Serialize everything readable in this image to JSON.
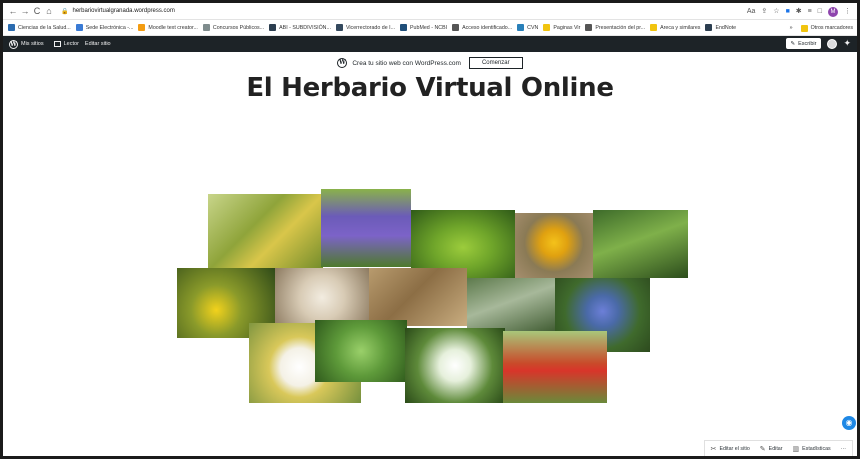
{
  "browser": {
    "url": "herbariovirtualgranada.wordpress.com",
    "profile_initial": "M",
    "nav": {
      "back": "←",
      "forward": "→",
      "reload": "C",
      "home": "⌂"
    },
    "toolbar_icons": [
      "text-size-icon",
      "share-icon",
      "star-icon",
      "extension-blue-icon",
      "puzzle-icon",
      "playlist-icon",
      "window-icon"
    ]
  },
  "bookmarks": [
    {
      "label": "Ciencias de la Salud...",
      "color": "#2b6cb0"
    },
    {
      "label": "Sede Electrónica -...",
      "color": "#3a7bd5"
    },
    {
      "label": "Moodle text creator...",
      "color": "#f39c12"
    },
    {
      "label": "Concursos Públicos...",
      "color": "#7f8c8d"
    },
    {
      "label": "ABI - SUBDIVISIÓN...",
      "color": "#2c3e50"
    },
    {
      "label": "Vicerrectorado de I...",
      "color": "#34495e"
    },
    {
      "label": "PubMed - NCBI",
      "color": "#1f4e79"
    },
    {
      "label": "Acceso identificado...",
      "color": "#555555"
    },
    {
      "label": "CVN",
      "color": "#2980b9"
    },
    {
      "label": "Paginas Vir",
      "color": "#f1c40f"
    },
    {
      "label": "Presentación del pr...",
      "color": "#555555"
    },
    {
      "label": "Areca y similares",
      "color": "#f1c40f"
    },
    {
      "label": "EndNote",
      "color": "#2c3e50"
    }
  ],
  "bookmarks_more": "»",
  "bookmarks_other": "Otros marcadores",
  "wpbar": {
    "my_sites": "Mis sitios",
    "reader": "Lector",
    "edit_site": "Editar sitio",
    "write": "Escribir"
  },
  "promo": {
    "text": "Crea tu sitio web con WordPress.com",
    "button": "Comenzar"
  },
  "site_title": "El Herbario Virtual Online",
  "collage": [
    {
      "name": "collage-hops",
      "bg": "linear-gradient(135deg,#c8d58a 0%,#8fa43a 40%,#d9c64a 60%,#6f8a2a 100%)"
    },
    {
      "name": "collage-lavender",
      "bg": "linear-gradient(180deg,#8ab24a 0%,#6b5bb8 35%,#7c63c8 60%,#4e7a2c 100%)"
    },
    {
      "name": "collage-ginkgo",
      "bg": "radial-gradient(ellipse at 50% 55%,#9ccc3c 0%,#6fa52a 40%,#2f5a18 100%)"
    },
    {
      "name": "collage-marigold",
      "bg": "radial-gradient(circle at 50% 45%,#f4c21a 0%,#e0a110 25%,#8a7a55 55%,#a89070 100%)"
    },
    {
      "name": "collage-horsetail",
      "bg": "linear-gradient(160deg,#3d6b2a 0%,#7fb04a 45%,#2c4d1c 100%)"
    },
    {
      "name": "collage-st-johns-wort",
      "bg": "radial-gradient(circle at 40% 60%,#f2d21c 0%,#8a9a2a 35%,#2f4a18 100%)"
    },
    {
      "name": "collage-garlic",
      "bg": "radial-gradient(circle at 50% 50%,#f2ece0 0%,#d8cbb5 40%,#8c7a60 100%)"
    },
    {
      "name": "collage-roots",
      "bg": "linear-gradient(135deg,#b89b6e 0%,#8c6e45 45%,#c9ad80 100%)"
    },
    {
      "name": "collage-shrub",
      "bg": "linear-gradient(160deg,#5d7a4c 0%,#a7b89a 45%,#3e5a30 100%)"
    },
    {
      "name": "collage-blue-flowers",
      "bg": "radial-gradient(circle at 50% 45%,#6c7fd8 0%,#4a6aa8 25%,#3f6a2c 60%,#2d4a1e 100%)"
    },
    {
      "name": "collage-chamomile",
      "bg": "radial-gradient(circle at 45% 55%,#ffffff 0%,#f4f1e6 25%,#d9c85a 40%,#6b8a3a 100%)"
    },
    {
      "name": "collage-mint",
      "bg": "radial-gradient(circle at 50% 50%,#9ad06a 0%,#5e9a3a 45%,#2f5a1c 100%)"
    },
    {
      "name": "collage-white-blossoms",
      "bg": "radial-gradient(circle at 50% 50%,#ffffff 0%,#e6f0dc 25%,#5e8a3a 60%,#2a4a18 100%)"
    },
    {
      "name": "collage-poppies",
      "bg": "linear-gradient(180deg,#a8c77a 0%,#c94a2a 45%,#d8352a 55%,#6a8a3a 100%)"
    }
  ],
  "footer": {
    "edit_site": "Editar el sitio",
    "editor": "Editar",
    "stats": "Estadísticas",
    "more": "···"
  }
}
